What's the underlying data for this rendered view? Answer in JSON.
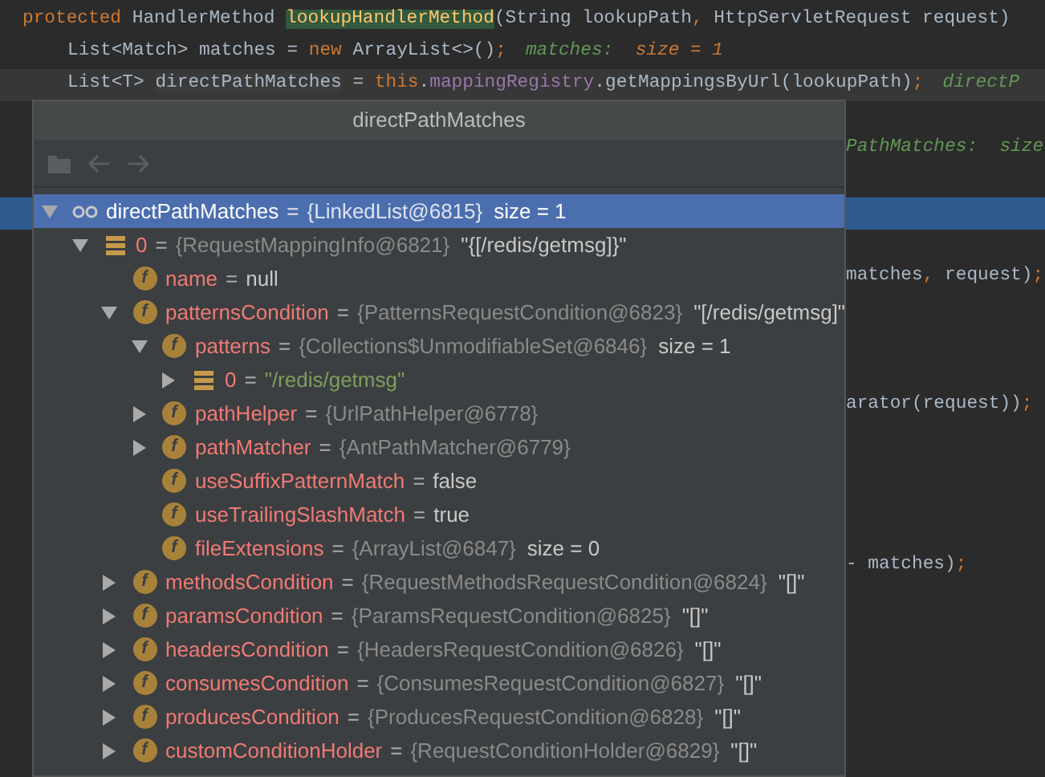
{
  "editor": {
    "lines": [
      {
        "kind": "code",
        "current": false,
        "indent": false,
        "tokens": [
          {
            "kind": "keyword",
            "text": "protected"
          },
          {
            "kind": "plain",
            "text": " HandlerMethod "
          },
          {
            "kind": "method-highlight",
            "text": "lookupHandlerMethod"
          },
          {
            "kind": "plain",
            "text": "(String lookupPath"
          },
          {
            "kind": "punct",
            "text": ","
          },
          {
            "kind": "plain",
            "text": " HttpServletRequest request)"
          }
        ]
      },
      {
        "kind": "code",
        "current": false,
        "indent": true,
        "tokens": [
          {
            "kind": "plain",
            "text": "List<Match> matches = "
          },
          {
            "kind": "keyword",
            "text": "new"
          },
          {
            "kind": "plain",
            "text": " ArrayList<>()"
          },
          {
            "kind": "punct",
            "text": ";"
          },
          {
            "kind": "hint-name",
            "text": "matches:  "
          },
          {
            "kind": "hint-value",
            "text": "size = 1"
          }
        ]
      },
      {
        "kind": "code",
        "current": true,
        "indent": true,
        "tokens": [
          {
            "kind": "plain",
            "text": "List<T> "
          },
          {
            "kind": "var-highlight",
            "text": "directPathMatches"
          },
          {
            "kind": "plain",
            "text": " = "
          },
          {
            "kind": "keyword",
            "text": "this"
          },
          {
            "kind": "plain",
            "text": "."
          },
          {
            "kind": "field",
            "text": "mappingRegistry"
          },
          {
            "kind": "plain",
            "text": ".getMappingsByUrl(lookupPath)"
          },
          {
            "kind": "punct",
            "text": ";"
          },
          {
            "kind": "hint-name",
            "text": "directP"
          }
        ]
      },
      {
        "kind": "blank"
      },
      {
        "kind": "tail",
        "tokens": [
          {
            "kind": "hint-tail",
            "text": "PathMatches:  size"
          }
        ]
      },
      {
        "kind": "blank"
      },
      {
        "kind": "execution"
      },
      {
        "kind": "blank"
      },
      {
        "kind": "tail",
        "tokens": [
          {
            "kind": "plain",
            "text": "matches"
          },
          {
            "kind": "punct",
            "text": ","
          },
          {
            "kind": "plain",
            "text": " request)"
          },
          {
            "kind": "punct",
            "text": ";"
          }
        ]
      },
      {
        "kind": "blank"
      },
      {
        "kind": "blank"
      },
      {
        "kind": "blank"
      },
      {
        "kind": "tail",
        "tokens": [
          {
            "kind": "plain",
            "text": "arator(request))"
          },
          {
            "kind": "punct",
            "text": ";"
          }
        ]
      },
      {
        "kind": "blank"
      },
      {
        "kind": "blank"
      },
      {
        "kind": "blank"
      },
      {
        "kind": "blank"
      },
      {
        "kind": "tail",
        "tokens": [
          {
            "kind": "plain",
            "text": "- matches)"
          },
          {
            "kind": "punct",
            "text": ";"
          }
        ]
      }
    ]
  },
  "popup": {
    "title": "directPathMatches",
    "toolbar": [
      {
        "kind": "folder",
        "disabled": true
      },
      {
        "kind": "back",
        "disabled": true
      },
      {
        "kind": "forward",
        "disabled": true
      }
    ],
    "tree": [
      {
        "kind": "watch",
        "name": "directPathMatches",
        "op": "=",
        "ref": "{LinkedList@6815}",
        "value": {
          "kind": "plain",
          "text": "size = 1"
        },
        "expanded": true,
        "selected": true,
        "children": [
          {
            "kind": "array",
            "name": "0",
            "op": "=",
            "ref": "{RequestMappingInfo@6821}",
            "value": {
              "kind": "plain",
              "text": "\"{[/redis/getmsg]}\""
            },
            "expanded": true,
            "selected": false,
            "children": [
              {
                "kind": "field",
                "badge": "f",
                "name": "name",
                "op": "=",
                "value": {
                  "kind": "plain",
                  "text": "null"
                },
                "selected": false
              },
              {
                "kind": "field",
                "badge": "f",
                "name": "patternsCondition",
                "op": "=",
                "ref": "{PatternsRequestCondition@6823}",
                "value": {
                  "kind": "plain",
                  "text": "\"[/redis/getmsg]\""
                },
                "expanded": true,
                "selected": false,
                "children": [
                  {
                    "kind": "field",
                    "badge": "f",
                    "name": "patterns",
                    "op": "=",
                    "ref": "{Collections$UnmodifiableSet@6846}",
                    "value": {
                      "kind": "plain",
                      "text": "size = 1"
                    },
                    "expanded": true,
                    "selected": false,
                    "children": [
                      {
                        "kind": "array",
                        "name": "0",
                        "op": "=",
                        "value": {
                          "kind": "string",
                          "text": "\"/redis/getmsg\""
                        },
                        "expanded": false,
                        "selected": false
                      }
                    ]
                  },
                  {
                    "kind": "field",
                    "badge": "f",
                    "name": "pathHelper",
                    "op": "=",
                    "ref": "{UrlPathHelper@6778}",
                    "expanded": false,
                    "selected": false
                  },
                  {
                    "kind": "field",
                    "badge": "f",
                    "name": "pathMatcher",
                    "op": "=",
                    "ref": "{AntPathMatcher@6779}",
                    "expanded": false,
                    "selected": false
                  },
                  {
                    "kind": "field",
                    "badge": "f",
                    "name": "useSuffixPatternMatch",
                    "op": "=",
                    "value": {
                      "kind": "plain",
                      "text": "false"
                    },
                    "selected": false
                  },
                  {
                    "kind": "field",
                    "badge": "f",
                    "name": "useTrailingSlashMatch",
                    "op": "=",
                    "value": {
                      "kind": "plain",
                      "text": "true"
                    },
                    "selected": false
                  },
                  {
                    "kind": "field",
                    "badge": "f",
                    "name": "fileExtensions",
                    "op": "=",
                    "ref": "{ArrayList@6847}",
                    "value": {
                      "kind": "plain",
                      "text": "size = 0"
                    },
                    "selected": false
                  }
                ]
              },
              {
                "kind": "field",
                "badge": "f",
                "name": "methodsCondition",
                "op": "=",
                "ref": "{RequestMethodsRequestCondition@6824}",
                "value": {
                  "kind": "plain",
                  "text": "\"[]\""
                },
                "expanded": false,
                "selected": false
              },
              {
                "kind": "field",
                "badge": "f",
                "name": "paramsCondition",
                "op": "=",
                "ref": "{ParamsRequestCondition@6825}",
                "value": {
                  "kind": "plain",
                  "text": "\"[]\""
                },
                "expanded": false,
                "selected": false
              },
              {
                "kind": "field",
                "badge": "f",
                "name": "headersCondition",
                "op": "=",
                "ref": "{HeadersRequestCondition@6826}",
                "value": {
                  "kind": "plain",
                  "text": "\"[]\""
                },
                "expanded": false,
                "selected": false
              },
              {
                "kind": "field",
                "badge": "f",
                "name": "consumesCondition",
                "op": "=",
                "ref": "{ConsumesRequestCondition@6827}",
                "value": {
                  "kind": "plain",
                  "text": "\"[]\""
                },
                "expanded": false,
                "selected": false
              },
              {
                "kind": "field",
                "badge": "f",
                "name": "producesCondition",
                "op": "=",
                "ref": "{ProducesRequestCondition@6828}",
                "value": {
                  "kind": "plain",
                  "text": "\"[]\""
                },
                "expanded": false,
                "selected": false
              },
              {
                "kind": "field",
                "badge": "f",
                "name": "customConditionHolder",
                "op": "=",
                "ref": "{RequestConditionHolder@6829}",
                "value": {
                  "kind": "plain",
                  "text": "\"[]\""
                },
                "expanded": false,
                "selected": false
              }
            ]
          }
        ]
      }
    ]
  }
}
